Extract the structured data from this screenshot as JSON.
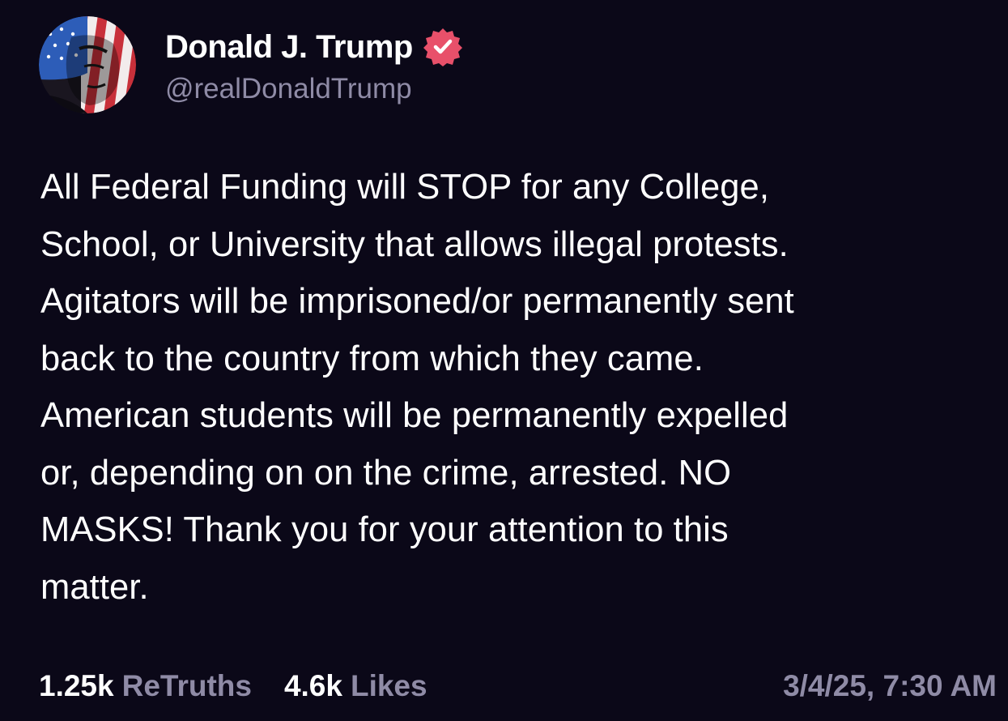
{
  "author": {
    "display_name": "Donald J. Trump",
    "handle": "@realDonaldTrump",
    "verified": true,
    "avatar": "avatar-flag-portrait"
  },
  "post": {
    "text": "All Federal Funding will STOP for any College,\nSchool, or University that allows illegal protests.\nAgitators will be imprisoned/or permanently sent\nback to the country from which they came.\nAmerican students will be permanently expelled\nor, depending on on the crime, arrested. NO\nMASKS! Thank you for your attention to this\nmatter."
  },
  "stats": {
    "retruths_count": "1.25k",
    "retruths_label": "ReTruths",
    "likes_count": "4.6k",
    "likes_label": "Likes",
    "timestamp": "3/4/25, 7:30 AM"
  },
  "icons": {
    "verified": "verified-badge-icon"
  },
  "colors": {
    "background": "#0b0818",
    "primary_text": "#ffffff",
    "secondary_text": "#8f8ba6",
    "verified_badge": "#e8506a"
  }
}
